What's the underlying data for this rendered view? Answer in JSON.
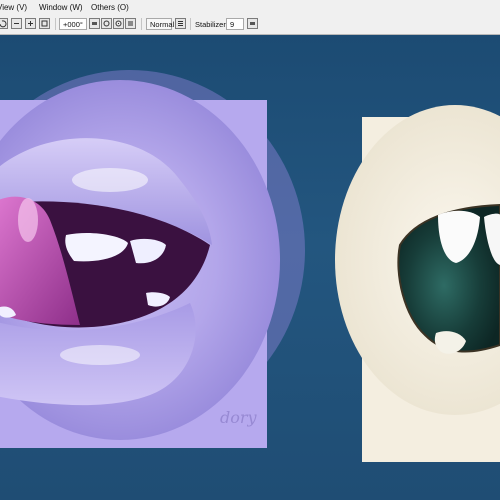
{
  "menubar": {
    "items": [
      {
        "label": "View (V)"
      },
      {
        "label": "Window (W)"
      },
      {
        "label": "Others (O)"
      }
    ]
  },
  "toolbar": {
    "rotation_value": "+000°",
    "blend_mode": "Normal",
    "stabilizer_label": "Stabilizer",
    "stabilizer_value": "9"
  },
  "canvas": {
    "background_color": "#1f4f78",
    "artworks": [
      {
        "name": "purple-mouth-painting",
        "colors": [
          "#b7a9ee",
          "#c45bb2",
          "#3c1346"
        ]
      },
      {
        "name": "cream-mouth-painting",
        "colors": [
          "#f5efe2",
          "#1c4a45",
          "#fafafa"
        ]
      }
    ],
    "signature_text": "dory"
  }
}
